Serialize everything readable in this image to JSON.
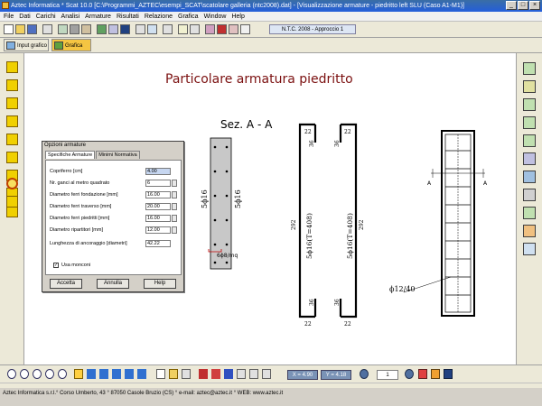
{
  "window": {
    "title": "Aztec Informatica * Scat 10.0 [C:\\Programmi_AZTEC\\esempi_SCAT\\scatolare galleria (ntc2008).dat] - [Visualizzazione armature - piedritto left SLU (Caso A1-M1)]",
    "btn_min": "_",
    "btn_max": "□",
    "btn_close": "×"
  },
  "menu": [
    "File",
    "Dati",
    "Carichi",
    "Analisi",
    "Armature",
    "Risultati",
    "Relazione",
    "Grafica",
    "Window",
    "Help"
  ],
  "toolbar": {
    "ntc": "N.T.C. 2008 - Approccio 1"
  },
  "tabs": {
    "input": "Input grafico",
    "grafica": "Grafica"
  },
  "drawing": {
    "title": "Particolare armatura piedritto",
    "section_label": "Sez. A - A",
    "bar_label_1": "5ϕ16",
    "bar_label_2": "5ϕ16",
    "stirrup_label": "6ϕ8/mq",
    "dim_22_top_a": "22",
    "dim_36_top_a": "36",
    "dim_292_a": "292",
    "bar_long_a": "5ϕ16(T=408)",
    "dim_36_bot_a": "36",
    "dim_22_bot_a": "22",
    "dim_22_top_b": "22",
    "dim_36_top_b": "36",
    "dim_292_b": "292",
    "bar_long_b": "5ϕ16(T=408)",
    "dim_36_bot_b": "36",
    "dim_22_bot_b": "22",
    "marker_left": "A",
    "marker_right": "A",
    "spacing_label": "ϕ12/40"
  },
  "dialog": {
    "title": "Opzioni armature",
    "tab1": "Specifiche Armature",
    "tab2": "Minimi Normativa",
    "fields": [
      {
        "label": "Copriferro [cm]",
        "value": "4.00"
      },
      {
        "label": "Nr. ganci al metro quadrato",
        "value": "6"
      },
      {
        "label": "Diametro ferri fondazione [mm]",
        "value": "16.00"
      },
      {
        "label": "Diametro ferri traverso [mm]",
        "value": "20.00"
      },
      {
        "label": "Diametro ferri piedritti [mm]",
        "value": "16.00"
      },
      {
        "label": "Diametro ripartitori [mm]",
        "value": "12.00"
      },
      {
        "label": "Lunghezza di ancoraggio [diametri]",
        "value": "42.22"
      }
    ],
    "checkbox_label": "Usa monconi",
    "checkbox_mark": "✓",
    "btn_ok": "Accetta",
    "btn_cancel": "Annulla",
    "btn_help": "Help"
  },
  "bottom": {
    "x_coord": "X = 4.90",
    "y_coord": "Y = 4.18",
    "page": "1"
  },
  "status": "Aztec Informatica s.r.l.° Corso Umberto, 43 ° 87050 Casole Bruzio (CS)  °  e-mail:  aztec@aztec.it  °  WEB: www.aztec.it"
}
